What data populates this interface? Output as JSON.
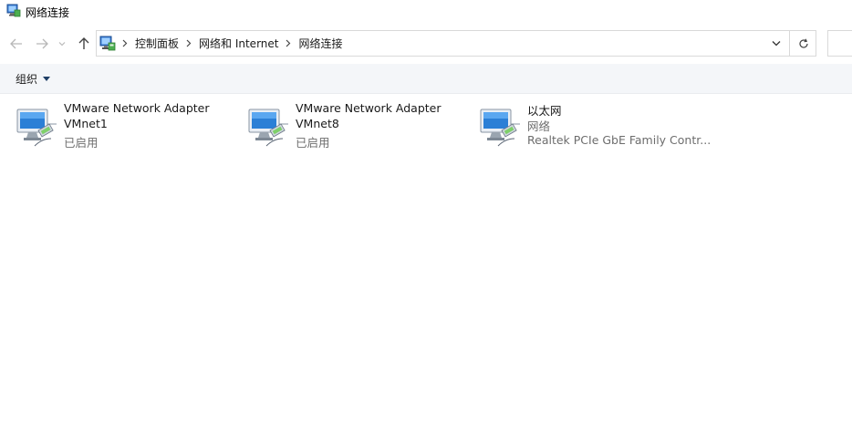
{
  "window": {
    "title": "网络连接",
    "icon": "network-connections-icon"
  },
  "nav": {
    "back_icon": "arrow-left-icon",
    "forward_icon": "arrow-right-icon",
    "recent_icon": "chevron-down-icon",
    "up_icon": "arrow-up-icon"
  },
  "address": {
    "crumbs": [
      "控制面板",
      "网络和 Internet",
      "网络连接"
    ],
    "dropdown_icon": "chevron-down-icon",
    "refresh_icon": "refresh-icon"
  },
  "commandbar": {
    "organize_label": "组织"
  },
  "connections": [
    {
      "name": "VMware Network Adapter",
      "detail": "VMnet1",
      "status": "已启用",
      "icon": "network-adapter-icon"
    },
    {
      "name": "VMware Network Adapter",
      "detail": "VMnet8",
      "status": "已启用",
      "icon": "network-adapter-icon"
    },
    {
      "name": "以太网",
      "detail": "网络",
      "status": "Realtek PCIe GbE Family Contr...",
      "icon": "network-adapter-icon"
    }
  ],
  "colors": {
    "accent": "#0063b1",
    "command_bar_bg": "#f4f6f9",
    "secondary_text": "#6d6d6d"
  }
}
